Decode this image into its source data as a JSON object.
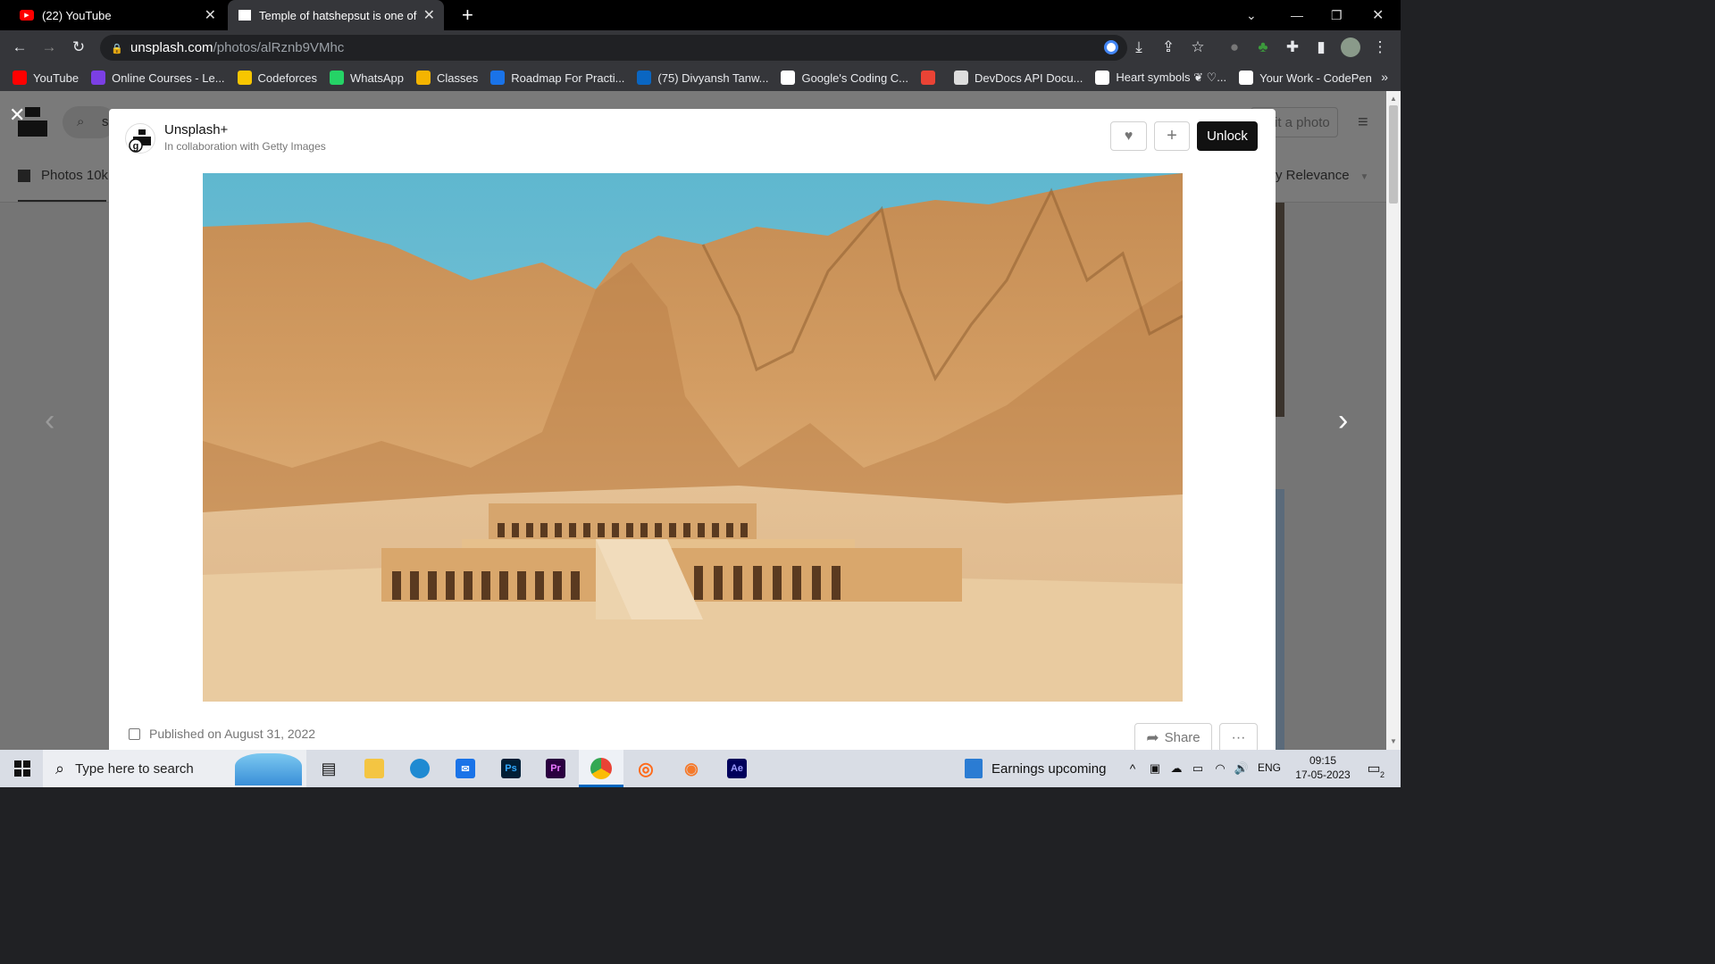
{
  "browser": {
    "tabs": [
      {
        "title": "(22) YouTube",
        "active": false
      },
      {
        "title": "Temple of hatshepsut is one of the",
        "active": true
      }
    ],
    "new_tab_label": "+",
    "url_host": "unsplash.com",
    "url_path": "/photos/alRznb9VMhc",
    "bookmarks": [
      {
        "label": "YouTube",
        "icon": "youtube-icon",
        "color": "#ff0000"
      },
      {
        "label": "Online Courses - Le...",
        "icon": "online-courses-icon",
        "color": "#7b3fe4"
      },
      {
        "label": "Codeforces",
        "icon": "codeforces-icon",
        "color": "#f7c600"
      },
      {
        "label": "WhatsApp",
        "icon": "whatsapp-icon",
        "color": "#25d366"
      },
      {
        "label": "Classes",
        "icon": "classes-icon",
        "color": "#f4b400"
      },
      {
        "label": "Roadmap For Practi...",
        "icon": "roadmap-icon",
        "color": "#1a73e8"
      },
      {
        "label": "(75) Divyansh Tanw...",
        "icon": "linkedin-icon",
        "color": "#0a66c2"
      },
      {
        "label": "Google's Coding C...",
        "icon": "google-icon",
        "color": "#ffffff"
      },
      {
        "label": "",
        "icon": "google-calendar-icon",
        "color": "#ea4335"
      },
      {
        "label": "DevDocs API Docu...",
        "icon": "devdocs-icon",
        "color": "#dddddd"
      },
      {
        "label": "Heart symbols ❦ ♡...",
        "icon": "heart-symbols-icon",
        "color": "#ffffff"
      },
      {
        "label": "Your Work - CodePen",
        "icon": "codepen-icon",
        "color": "#ffffff"
      }
    ]
  },
  "background_page": {
    "search_initial": "s",
    "photos_tab": "Photos 10k",
    "submit_partial": "it a photo",
    "sort_partial": "y Relevance"
  },
  "modal": {
    "brand": "Unsplash+",
    "subtitle": "In collaboration with Getty Images",
    "unlock_label": "Unlock",
    "published": "Published on August 31, 2022",
    "share_label": "Share",
    "more_label": "···",
    "photo_alt": "Temple of hatshepsut"
  },
  "taskbar": {
    "search_placeholder": "Type here to search",
    "weather": "Earnings upcoming",
    "lang": "ENG",
    "time": "09:15",
    "date": "17-05-2023",
    "notifications": "2"
  }
}
